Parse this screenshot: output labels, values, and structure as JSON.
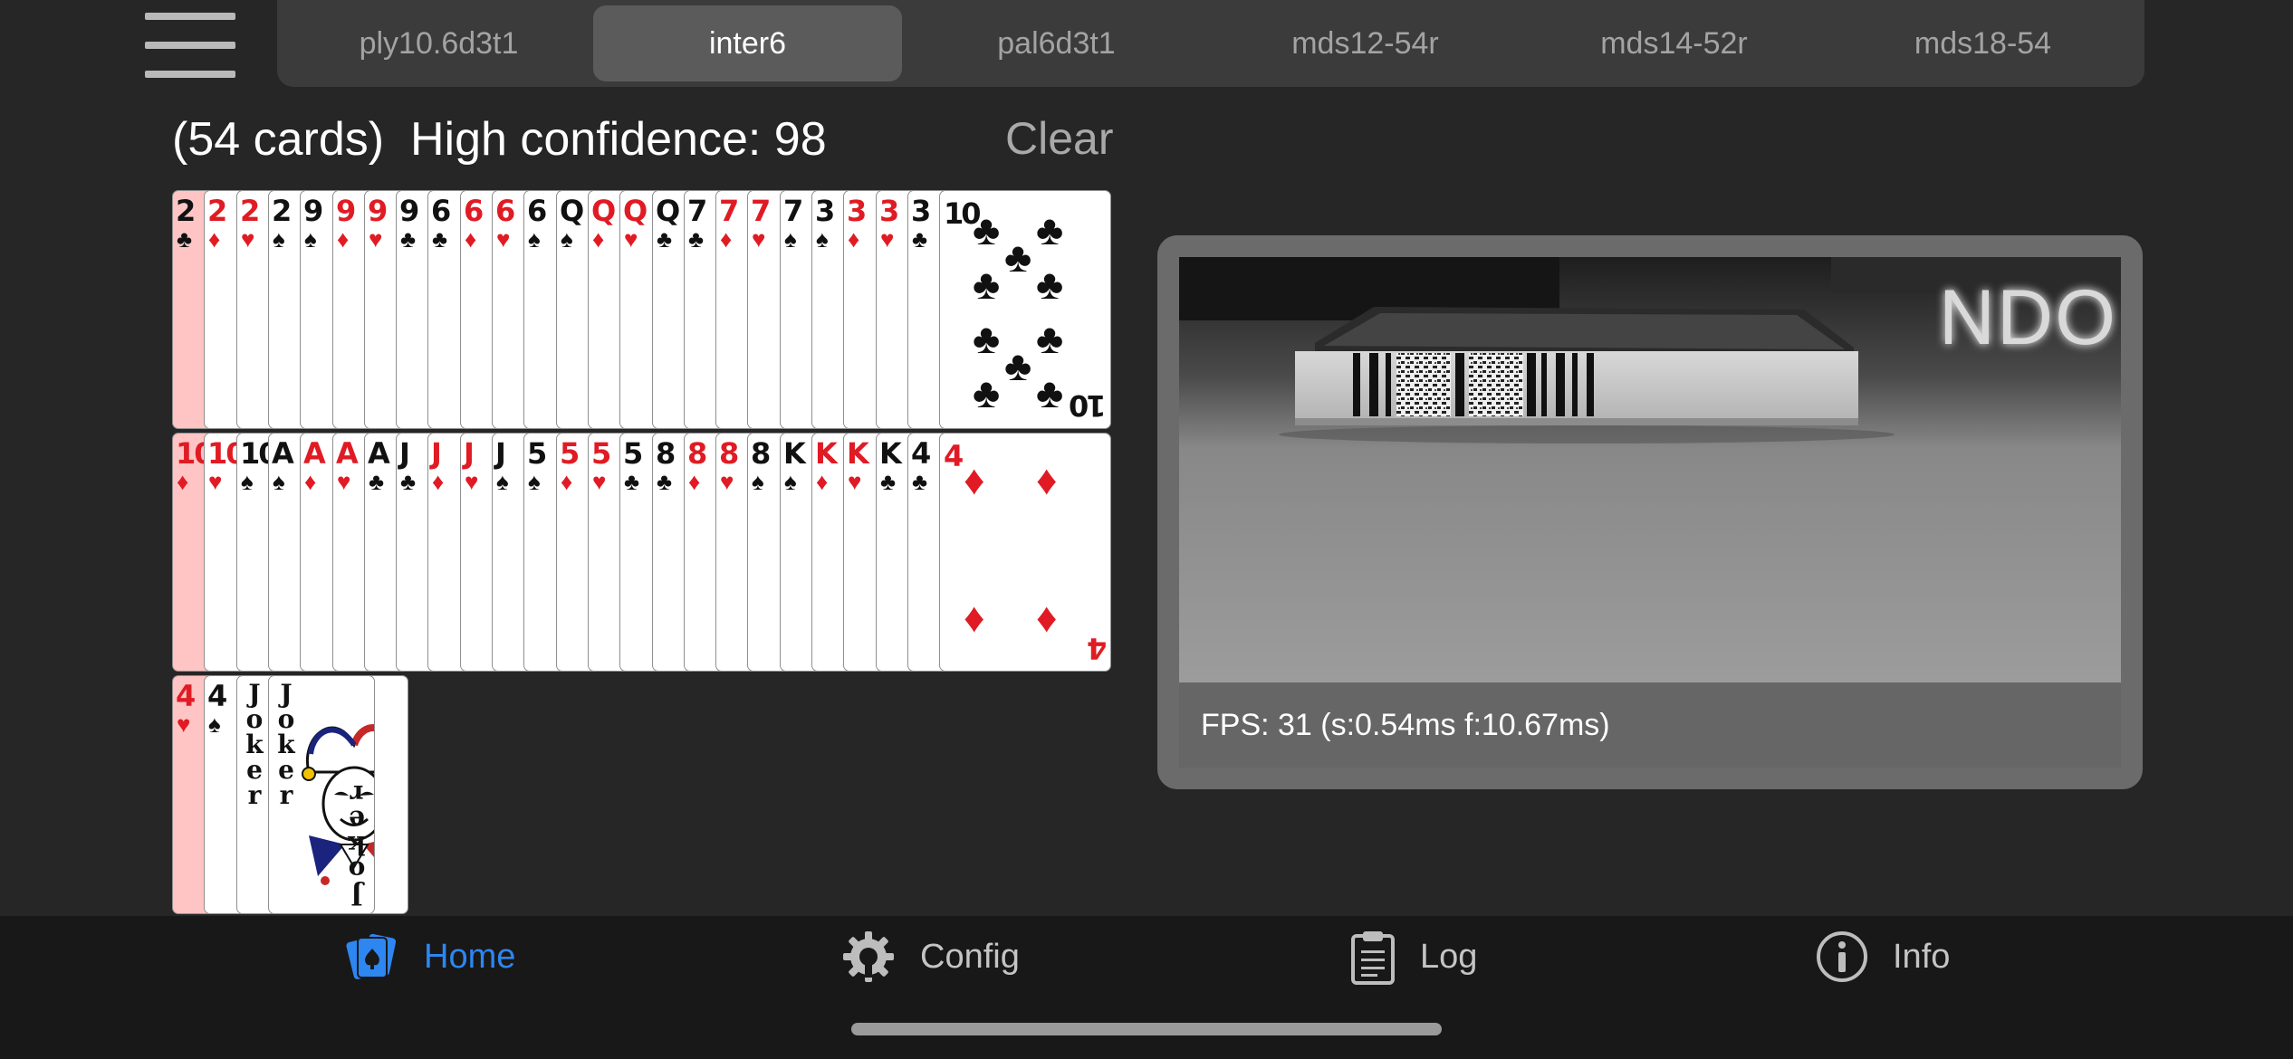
{
  "header": {
    "tabs": [
      {
        "label": "ply10.6d3t1",
        "selected": false
      },
      {
        "label": "inter6",
        "selected": true
      },
      {
        "label": "pal6d3t1",
        "selected": false
      },
      {
        "label": "mds12-54r",
        "selected": false
      },
      {
        "label": "mds14-52r",
        "selected": false
      },
      {
        "label": "mds18-54",
        "selected": false
      }
    ]
  },
  "summary": {
    "count_text": "(54 cards)",
    "confidence_text": "High confidence: 98",
    "clear_label": "Clear"
  },
  "cards": {
    "row1": [
      {
        "rank": "2",
        "suit": "♣",
        "color": "black"
      },
      {
        "rank": "2",
        "suit": "♦",
        "color": "red"
      },
      {
        "rank": "2",
        "suit": "♥",
        "color": "red"
      },
      {
        "rank": "2",
        "suit": "♠",
        "color": "black"
      },
      {
        "rank": "9",
        "suit": "♠",
        "color": "black"
      },
      {
        "rank": "9",
        "suit": "♦",
        "color": "red"
      },
      {
        "rank": "9",
        "suit": "♥",
        "color": "red"
      },
      {
        "rank": "9",
        "suit": "♣",
        "color": "black"
      },
      {
        "rank": "6",
        "suit": "♣",
        "color": "black"
      },
      {
        "rank": "6",
        "suit": "♦",
        "color": "red"
      },
      {
        "rank": "6",
        "suit": "♥",
        "color": "red"
      },
      {
        "rank": "6",
        "suit": "♠",
        "color": "black"
      },
      {
        "rank": "Q",
        "suit": "♠",
        "color": "black",
        "face": true
      },
      {
        "rank": "Q",
        "suit": "♦",
        "color": "red",
        "face": true
      },
      {
        "rank": "Q",
        "suit": "♥",
        "color": "red",
        "face": true
      },
      {
        "rank": "Q",
        "suit": "♣",
        "color": "black",
        "face": true
      },
      {
        "rank": "7",
        "suit": "♣",
        "color": "black"
      },
      {
        "rank": "7",
        "suit": "♦",
        "color": "red"
      },
      {
        "rank": "7",
        "suit": "♥",
        "color": "red"
      },
      {
        "rank": "7",
        "suit": "♠",
        "color": "black"
      },
      {
        "rank": "3",
        "suit": "♠",
        "color": "black"
      },
      {
        "rank": "3",
        "suit": "♦",
        "color": "red"
      },
      {
        "rank": "3",
        "suit": "♥",
        "color": "red"
      },
      {
        "rank": "3",
        "suit": "♣",
        "color": "black"
      },
      {
        "rank": "10",
        "suit": "♣",
        "color": "black",
        "big": true
      }
    ],
    "row2": [
      {
        "rank": "10",
        "suit": "♦",
        "color": "red"
      },
      {
        "rank": "10",
        "suit": "♥",
        "color": "red"
      },
      {
        "rank": "10",
        "suit": "♠",
        "color": "black"
      },
      {
        "rank": "A",
        "suit": "♠",
        "color": "black"
      },
      {
        "rank": "A",
        "suit": "♦",
        "color": "red"
      },
      {
        "rank": "A",
        "suit": "♥",
        "color": "red"
      },
      {
        "rank": "A",
        "suit": "♣",
        "color": "black"
      },
      {
        "rank": "J",
        "suit": "♣",
        "color": "black",
        "face": true
      },
      {
        "rank": "J",
        "suit": "♦",
        "color": "red",
        "face": true
      },
      {
        "rank": "J",
        "suit": "♥",
        "color": "red",
        "face": true
      },
      {
        "rank": "J",
        "suit": "♠",
        "color": "black",
        "face": true
      },
      {
        "rank": "5",
        "suit": "♠",
        "color": "black"
      },
      {
        "rank": "5",
        "suit": "♦",
        "color": "red"
      },
      {
        "rank": "5",
        "suit": "♥",
        "color": "red"
      },
      {
        "rank": "5",
        "suit": "♣",
        "color": "black"
      },
      {
        "rank": "8",
        "suit": "♣",
        "color": "black"
      },
      {
        "rank": "8",
        "suit": "♦",
        "color": "red"
      },
      {
        "rank": "8",
        "suit": "♥",
        "color": "red"
      },
      {
        "rank": "8",
        "suit": "♠",
        "color": "black"
      },
      {
        "rank": "K",
        "suit": "♠",
        "color": "black",
        "face": true
      },
      {
        "rank": "K",
        "suit": "♦",
        "color": "red",
        "face": true
      },
      {
        "rank": "K",
        "suit": "♥",
        "color": "red",
        "face": true
      },
      {
        "rank": "K",
        "suit": "♣",
        "color": "black",
        "face": true
      },
      {
        "rank": "4",
        "suit": "♣",
        "color": "black"
      },
      {
        "rank": "4",
        "suit": "♦",
        "color": "red",
        "big": true
      }
    ],
    "row3": [
      {
        "rank": "4",
        "suit": "♥",
        "color": "red"
      },
      {
        "rank": "4",
        "suit": "♠",
        "color": "black"
      },
      {
        "rank": "Joker",
        "color": "black",
        "joker": true
      },
      {
        "rank": "Joker",
        "color": "black",
        "joker": true,
        "big": true
      }
    ]
  },
  "camera": {
    "overlay_text": "NDO",
    "fps_text": "FPS: 31 (s:0.54ms f:10.67ms)"
  },
  "bottom_nav": [
    {
      "label": "Home",
      "icon": "cards-icon",
      "active": true
    },
    {
      "label": "Config",
      "icon": "gear-icon",
      "active": false
    },
    {
      "label": "Log",
      "icon": "clipboard-icon",
      "active": false
    },
    {
      "label": "Info",
      "icon": "info-icon",
      "active": false
    }
  ],
  "colors": {
    "accent": "#2e86f0",
    "red_suit": "#e01b24",
    "first_card_tint": "#ffc4c4"
  }
}
